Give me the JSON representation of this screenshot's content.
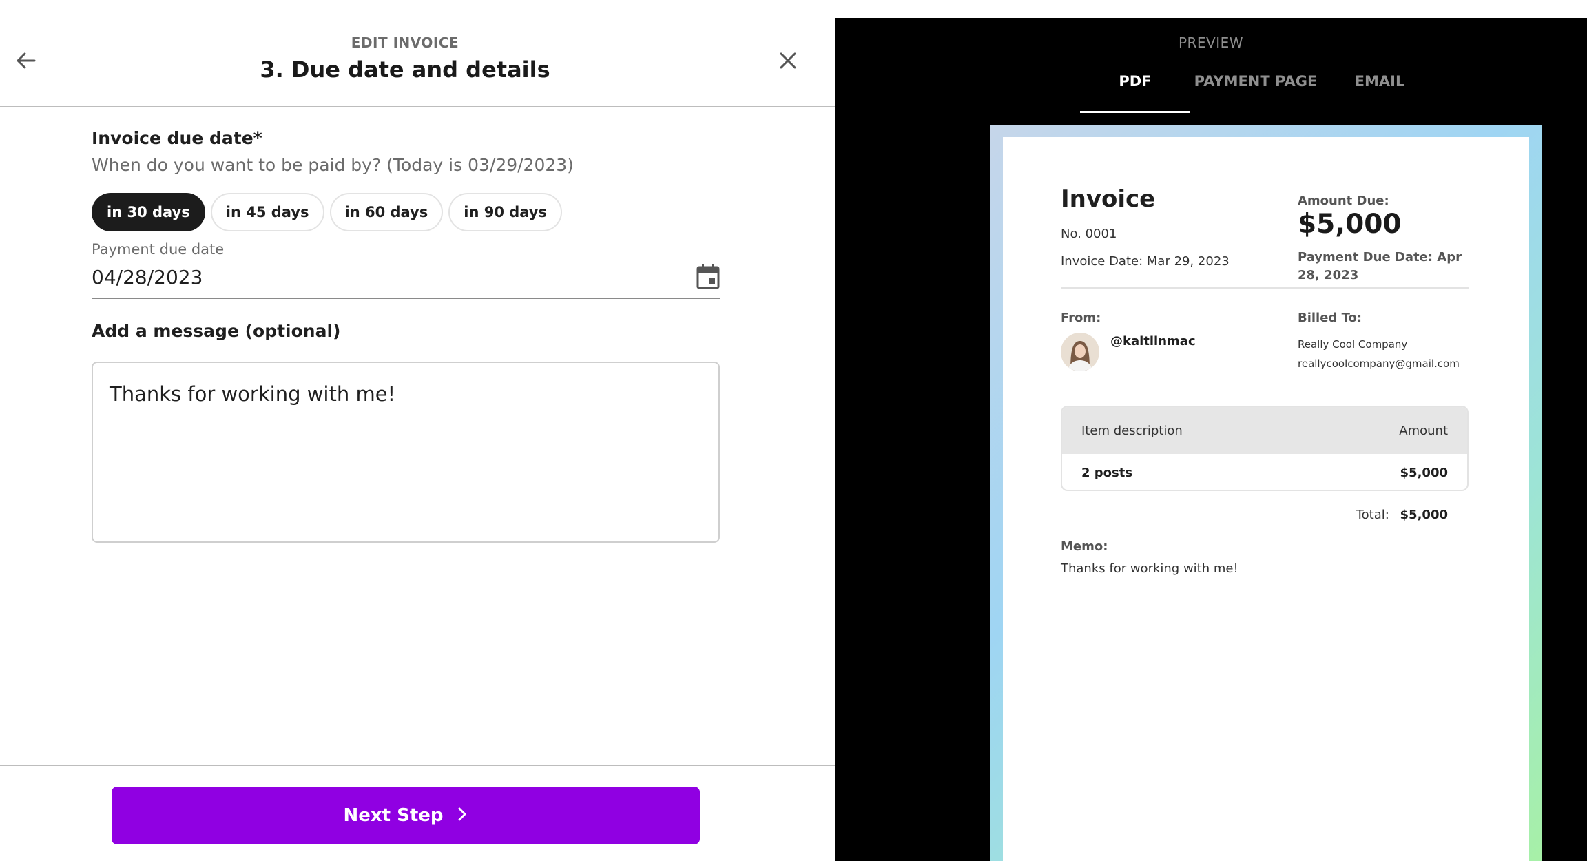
{
  "editor": {
    "kicker": "EDIT INVOICE",
    "title": "3. Due date and details",
    "icons": {
      "back": "arrow-left-icon",
      "close": "close-icon",
      "calendar": "calendar-icon",
      "next": "chevron-right-icon"
    },
    "due_date": {
      "label": "Invoice due date*",
      "hint": "When do you want to be paid by? (Today is 03/29/2023)",
      "options": [
        "in 30 days",
        "in 45 days",
        "in 60 days",
        "in 90 days"
      ],
      "selected": "in 30 days",
      "field_label": "Payment due date",
      "field_value": "04/28/2023"
    },
    "message": {
      "label": "Add a message (optional)",
      "value": "Thanks for working with me!"
    },
    "next_label": "Next Step"
  },
  "preview": {
    "kicker": "PREVIEW",
    "tabs": [
      "PDF",
      "PAYMENT PAGE",
      "EMAIL"
    ],
    "active_tab": "PDF",
    "invoice": {
      "title": "Invoice",
      "number": "No. 0001",
      "date": "Invoice Date: Mar 29, 2023",
      "amount_label": "Amount Due:",
      "amount": "$5,000",
      "due": "Payment Due Date: Apr 28, 2023",
      "from_label": "From:",
      "from_handle": "@kaitlinmac",
      "billed_label": "Billed To:",
      "billed_name": "Really Cool Company",
      "billed_email": "reallycoolcompany@gmail.com",
      "table_headers": [
        "Item description",
        "Amount"
      ],
      "rows": [
        {
          "desc": "2 posts",
          "amount": "$5,000"
        }
      ],
      "total_label": "Total:",
      "total": "$5,000",
      "memo_label": "Memo:",
      "memo": "Thanks for working with me!"
    },
    "colors": {
      "accent_button": "#9000e2",
      "gradient_start": "#c6d6ea",
      "gradient_end": "#a7f0a7"
    }
  }
}
